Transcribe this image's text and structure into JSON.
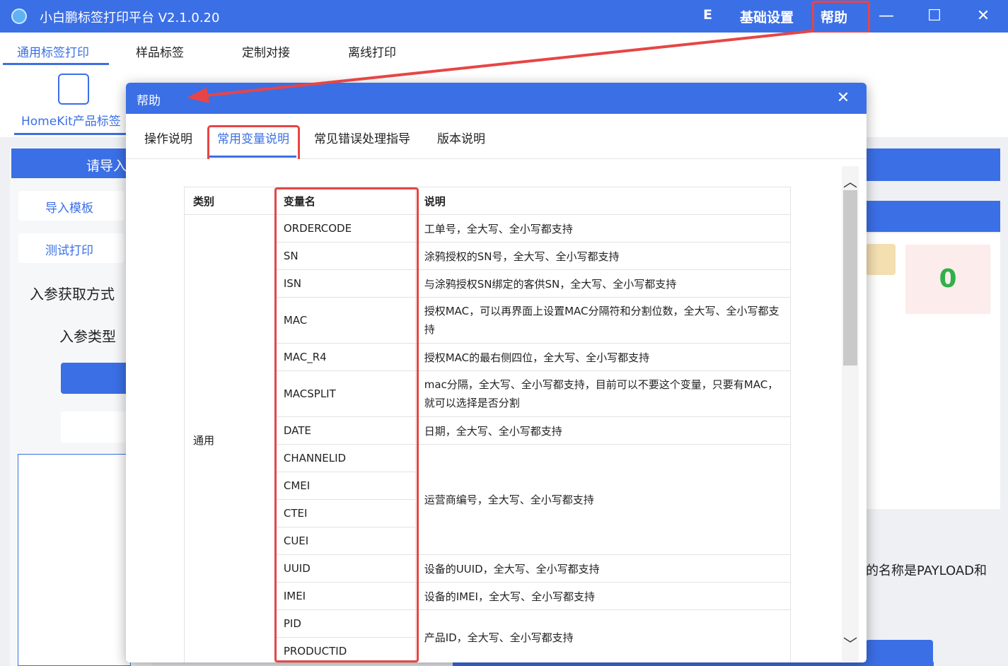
{
  "app": {
    "title": "小白鹏标签打印平台 V2.1.0.20",
    "menu": {
      "e_label": "E",
      "settings_label": "基础设置",
      "help_label": "帮助"
    },
    "window_controls": {
      "minimize": "—",
      "maximize": "☐",
      "close": "✕"
    }
  },
  "main_tabs": [
    "通用标签打印",
    "样品标签",
    "定制对接",
    "离线打印"
  ],
  "product_tab": {
    "label": "HomeKit产品标签"
  },
  "left_panel": {
    "header": "请导入",
    "buttons": [
      "导入模板",
      "测试打印"
    ],
    "param_source_label": "入参获取方式",
    "param_type_label": "入参类型"
  },
  "right_panel": {
    "counter": "0",
    "payload_text": "的名称是PAYLOAD和"
  },
  "dialog": {
    "title": "帮助",
    "close": "✕",
    "tabs": [
      "操作说明",
      "常用变量说明",
      "常见错误处理指导",
      "版本说明"
    ],
    "active_tab_index": 1,
    "table": {
      "headers": {
        "category": "类别",
        "variable": "变量名",
        "description": "说明"
      },
      "category": "通用",
      "rows": [
        {
          "name": "ORDERCODE",
          "desc": "工单号，全大写、全小写都支持"
        },
        {
          "name": "SN",
          "desc": "涂鸦授权的SN号，全大写、全小写都支持"
        },
        {
          "name": "ISN",
          "desc": "与涂鸦授权SN绑定的客供SN，全大写、全小写都支持"
        },
        {
          "name": "MAC",
          "desc": "授权MAC，可以再界面上设置MAC分隔符和分割位数，全大写、全小写都支持"
        },
        {
          "name": "MAC_R4",
          "desc": "授权MAC的最右侧四位，全大写、全小写都支持"
        },
        {
          "name": "MACSPLIT",
          "desc": "mac分隔，全大写、全小写都支持，目前可以不要这个变量，只要有MAC，就可以选择是否分割"
        },
        {
          "name": "DATE",
          "desc": "日期，全大写、全小写都支持"
        },
        {
          "name": "CHANNELID"
        },
        {
          "name": "CMEI"
        },
        {
          "name": "CTEI"
        },
        {
          "name": "CUEI"
        },
        {
          "name": "UUID",
          "desc": "设备的UUID，全大写、全小写都支持"
        },
        {
          "name": "IMEI",
          "desc": "设备的IMEI，全大写、全小写都支持"
        },
        {
          "name": "PID"
        },
        {
          "name": "PRODUCTID"
        }
      ],
      "carrier_desc": "运营商编号，全大写、全小写都支持",
      "product_desc": "产品ID，全大写、全小写都支持"
    }
  },
  "colors": {
    "accent": "#3b6fe6",
    "highlight": "#e74545",
    "success": "#2fb14a"
  }
}
